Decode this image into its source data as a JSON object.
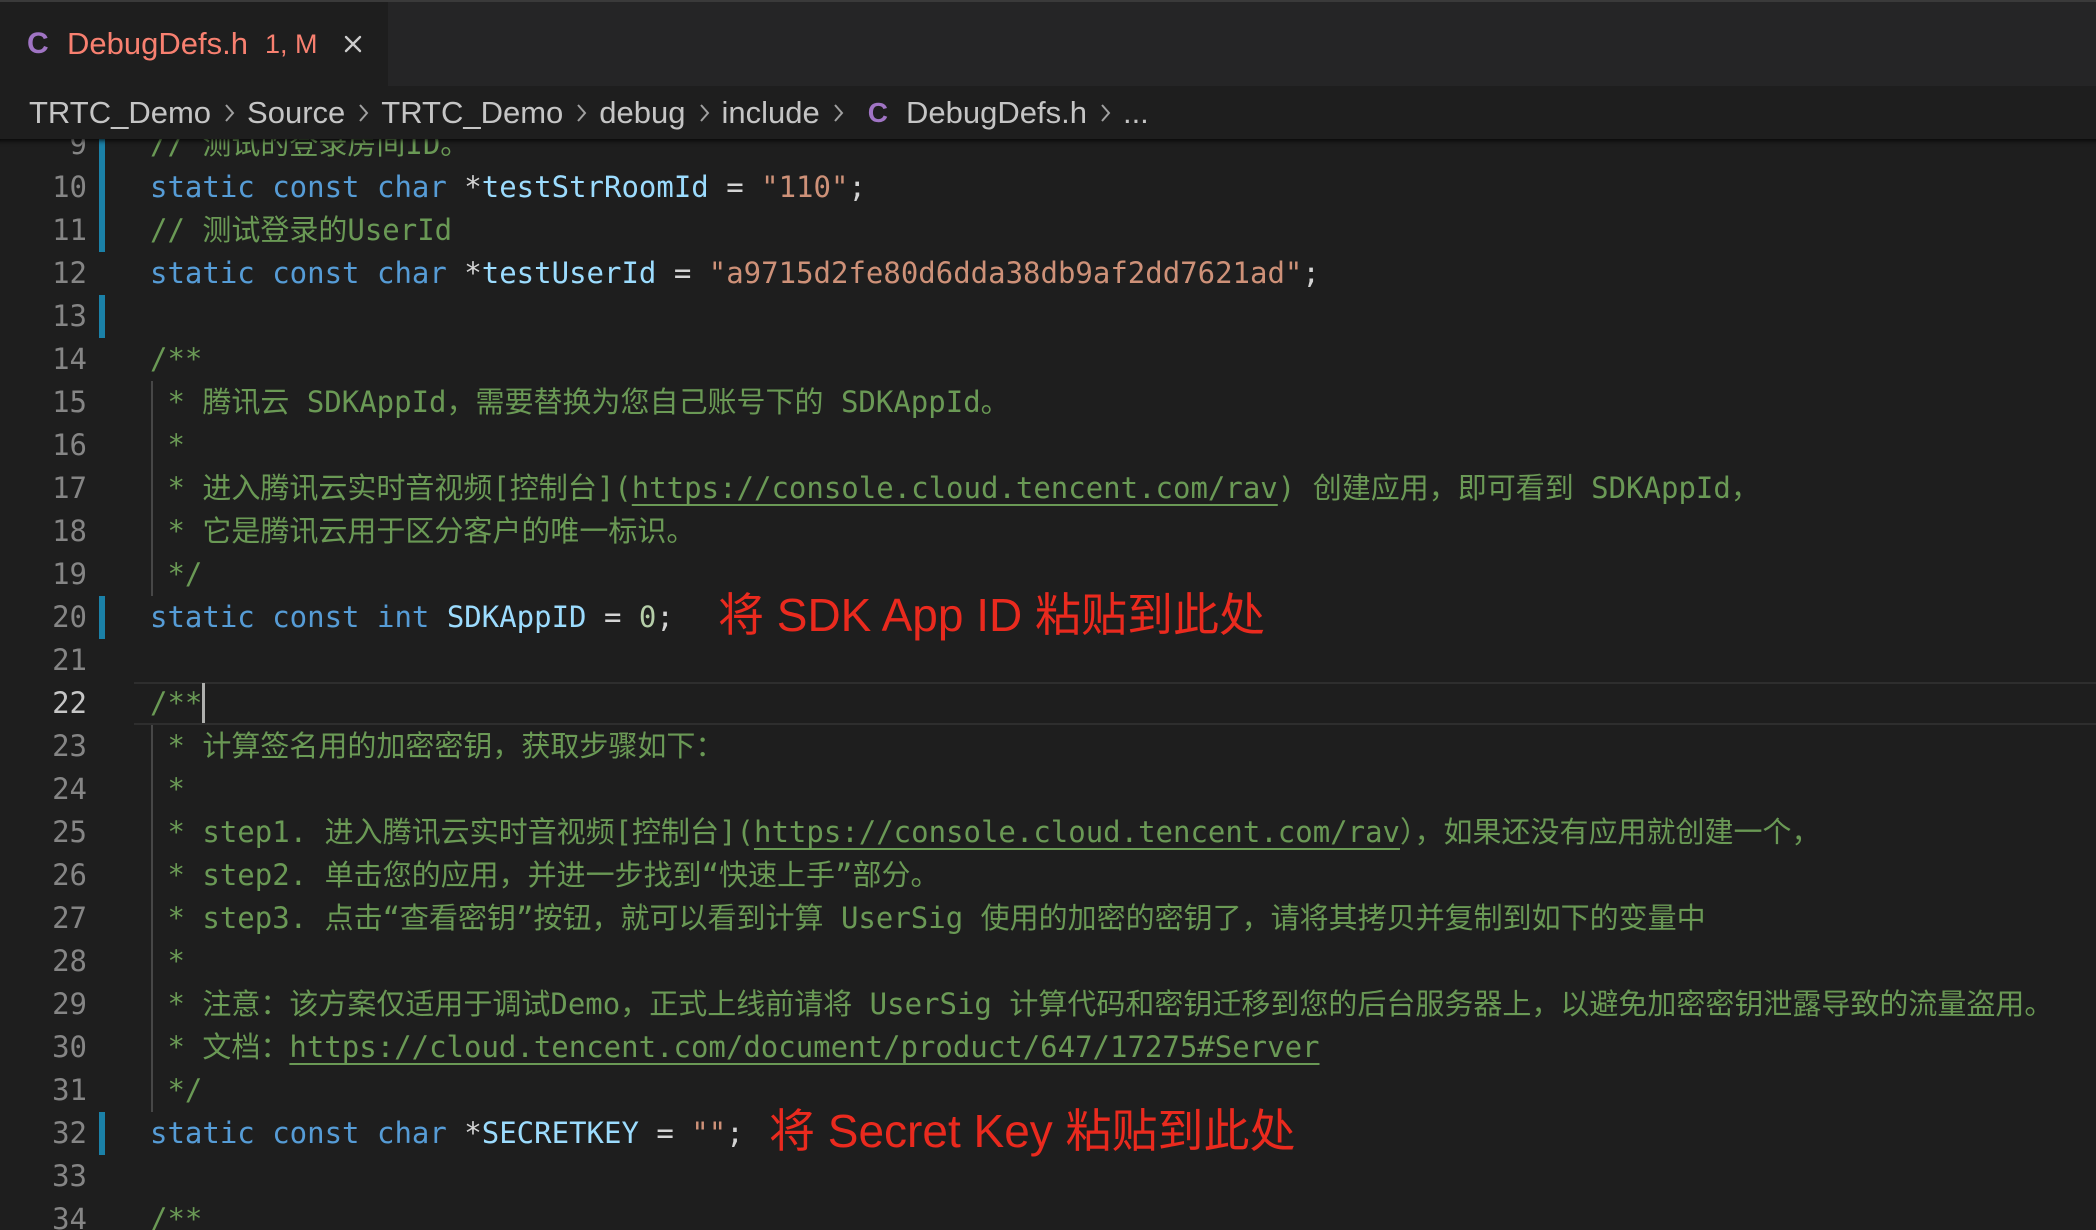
{
  "tab": {
    "icon": "c-file-icon",
    "icon_glyph": "C",
    "title": "DebugDefs.h",
    "status": "1, M",
    "close_icon": "close-icon"
  },
  "breadcrumb": {
    "separator_icon": "chevron-right-icon",
    "items": [
      {
        "label": "TRTC_Demo"
      },
      {
        "label": "Source"
      },
      {
        "label": "TRTC_Demo"
      },
      {
        "label": "debug"
      },
      {
        "label": "include"
      },
      {
        "label": "DebugDefs.h",
        "icon": "c-file-icon",
        "icon_glyph": "C"
      },
      {
        "label": "..."
      }
    ]
  },
  "colors": {
    "keyword": "#569cd6",
    "variable": "#9cdcfe",
    "operator": "#d4d4d4",
    "string": "#ce9178",
    "number": "#b5cea8",
    "comment": "#6a9955",
    "link": "#6a9955",
    "annotation": "#ea2a1e",
    "tab_title": "#f88070",
    "file_icon": "#a074c4",
    "breadcrumb_text": "#c5c5c5",
    "git_modified": "#1b81a8",
    "line_number": "#858585",
    "line_number_active": "#c6c6c6",
    "close_icon": "#cccccc",
    "chevron": "#a0a0a0"
  },
  "editor": {
    "current_line": 22,
    "lines": [
      {
        "n": 9,
        "modified": true,
        "tokens": [
          [
            "// 测试的登录房间ID。",
            "comment"
          ]
        ]
      },
      {
        "n": 10,
        "modified": true,
        "tokens": [
          [
            "static ",
            "keyword"
          ],
          [
            "const ",
            "keyword"
          ],
          [
            "char ",
            "keyword"
          ],
          [
            "*",
            "operator"
          ],
          [
            "testStrRoomId",
            "variable"
          ],
          [
            " = ",
            "operator"
          ],
          [
            "\"110\"",
            "string"
          ],
          [
            ";",
            "operator"
          ]
        ]
      },
      {
        "n": 11,
        "modified": true,
        "tokens": [
          [
            "// 测试登录的UserId",
            "comment"
          ]
        ]
      },
      {
        "n": 12,
        "tokens": [
          [
            "static ",
            "keyword"
          ],
          [
            "const ",
            "keyword"
          ],
          [
            "char ",
            "keyword"
          ],
          [
            "*",
            "operator"
          ],
          [
            "testUserId",
            "variable"
          ],
          [
            " = ",
            "operator"
          ],
          [
            "\"a9715d2fe80d6dda38db9af2dd7621ad\"",
            "string"
          ],
          [
            ";",
            "operator"
          ]
        ]
      },
      {
        "n": 13,
        "modified": true,
        "tokens": []
      },
      {
        "n": 14,
        "tokens": [
          [
            "/**",
            "comment"
          ]
        ]
      },
      {
        "n": 15,
        "tokens": [
          [
            " * 腾讯云 SDKAppId，需要替换为您自己账号下的 SDKAppId。",
            "comment"
          ]
        ]
      },
      {
        "n": 16,
        "tokens": [
          [
            " *",
            "comment"
          ]
        ]
      },
      {
        "n": 17,
        "tokens": [
          [
            " * 进入腾讯云实时音视频[控制台](",
            "comment"
          ],
          [
            "https://console.cloud.tencent.com/rav",
            "link"
          ],
          [
            ") 创建应用，即可看到 SDKAppId，",
            "comment"
          ]
        ]
      },
      {
        "n": 18,
        "tokens": [
          [
            " * 它是腾讯云用于区分客户的唯一标识。",
            "comment"
          ]
        ]
      },
      {
        "n": 19,
        "tokens": [
          [
            " */",
            "comment"
          ]
        ]
      },
      {
        "n": 20,
        "modified": true,
        "tokens": [
          [
            "static ",
            "keyword"
          ],
          [
            "const ",
            "keyword"
          ],
          [
            "int ",
            "keyword"
          ],
          [
            "SDKAppID",
            "variable"
          ],
          [
            " = ",
            "operator"
          ],
          [
            "0",
            "number"
          ],
          [
            ";",
            "operator"
          ]
        ],
        "annotation": "将 SDK App ID 粘贴到此处"
      },
      {
        "n": 21,
        "tokens": []
      },
      {
        "n": 22,
        "tokens": [
          [
            "/**",
            "comment"
          ]
        ]
      },
      {
        "n": 23,
        "tokens": [
          [
            " * 计算签名用的加密密钥，获取步骤如下：",
            "comment"
          ]
        ]
      },
      {
        "n": 24,
        "tokens": [
          [
            " *",
            "comment"
          ]
        ]
      },
      {
        "n": 25,
        "tokens": [
          [
            " * step1. 进入腾讯云实时音视频[控制台](",
            "comment"
          ],
          [
            "https://console.cloud.tencent.com/rav",
            "link"
          ],
          [
            "），如果还没有应用就创建一个，",
            "comment"
          ]
        ]
      },
      {
        "n": 26,
        "tokens": [
          [
            " * step2. 单击您的应用，并进一步找到“快速上手”部分。",
            "comment"
          ]
        ]
      },
      {
        "n": 27,
        "tokens": [
          [
            " * step3. 点击“查看密钥”按钮，就可以看到计算 UserSig 使用的加密的密钥了，请将其拷贝并复制到如下的变量中",
            "comment"
          ]
        ]
      },
      {
        "n": 28,
        "tokens": [
          [
            " *",
            "comment"
          ]
        ]
      },
      {
        "n": 29,
        "tokens": [
          [
            " * 注意：该方案仅适用于调试Demo，正式上线前请将 UserSig 计算代码和密钥迁移到您的后台服务器上，以避免加密密钥泄露导致的流量盗用。",
            "comment"
          ]
        ]
      },
      {
        "n": 30,
        "tokens": [
          [
            " * 文档：",
            "comment"
          ],
          [
            "https://cloud.tencent.com/document/product/647/17275#Server",
            "link"
          ]
        ]
      },
      {
        "n": 31,
        "tokens": [
          [
            " */",
            "comment"
          ]
        ]
      },
      {
        "n": 32,
        "modified": true,
        "tokens": [
          [
            "static ",
            "keyword"
          ],
          [
            "const ",
            "keyword"
          ],
          [
            "char ",
            "keyword"
          ],
          [
            "*",
            "operator"
          ],
          [
            "SECRETKEY",
            "variable"
          ],
          [
            " = ",
            "operator"
          ],
          [
            "\"\"",
            "string"
          ],
          [
            ";",
            "operator"
          ]
        ],
        "annotation": "将 Secret Key 粘贴到此处"
      },
      {
        "n": 33,
        "tokens": []
      },
      {
        "n": 34,
        "tokens": [
          [
            "/**",
            "comment"
          ]
        ]
      }
    ]
  }
}
